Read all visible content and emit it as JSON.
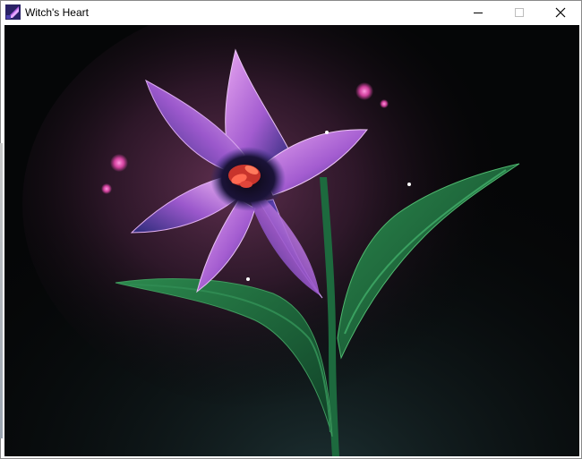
{
  "window": {
    "title": "Witch's Heart",
    "app_icon": "witch-hat-icon",
    "controls": [
      "minimize-icon",
      "maximize-icon",
      "close-icon"
    ]
  },
  "scene": {
    "subject": "glowing-purple-lily-flower",
    "palette": {
      "background": "#050607",
      "glow": "#5a2a4a",
      "petal_light": "#d98fe0",
      "petal_dark": "#3a2f8a",
      "stamen": "#e0453a",
      "leaf": "#1f6a3c",
      "leaf_dark": "#0f3f26",
      "sparkle": "#ff5fc4"
    }
  }
}
